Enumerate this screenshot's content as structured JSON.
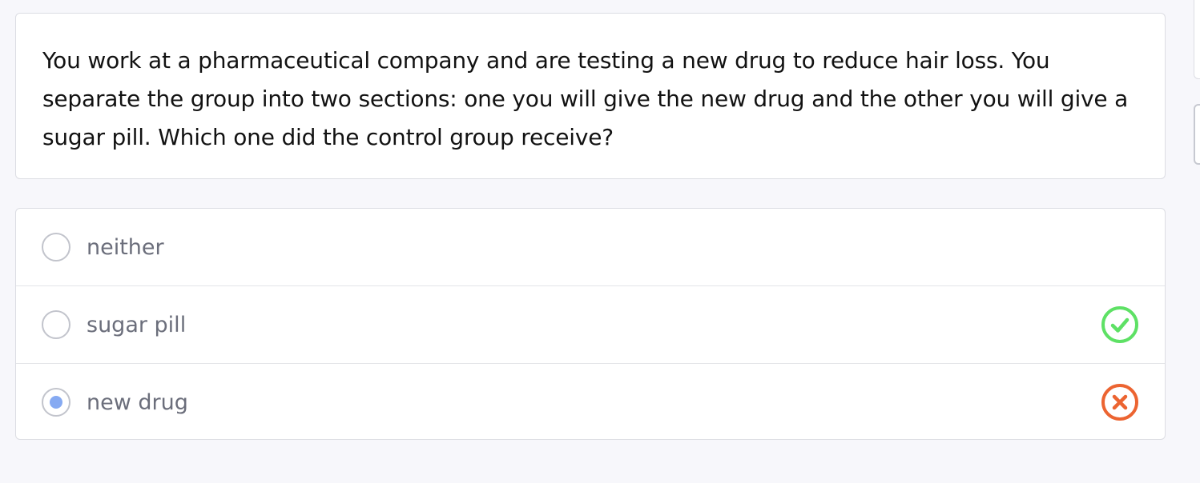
{
  "question": {
    "text": "You work at a pharmaceutical company and are testing a new drug to reduce hair loss. You separate the group into two sections: one you will give the new drug and the other you will give a sugar pill. Which one did the control group receive?"
  },
  "options": [
    {
      "label": "neither",
      "selected": false,
      "result": "none"
    },
    {
      "label": "sugar pill",
      "selected": false,
      "result": "correct"
    },
    {
      "label": "new drug",
      "selected": true,
      "result": "incorrect"
    }
  ],
  "icons": {
    "correct": "check-circle-icon",
    "incorrect": "x-circle-icon"
  },
  "colors": {
    "correct": "#5ee165",
    "incorrect": "#ec6431",
    "selected_dot": "#86aaf2"
  }
}
